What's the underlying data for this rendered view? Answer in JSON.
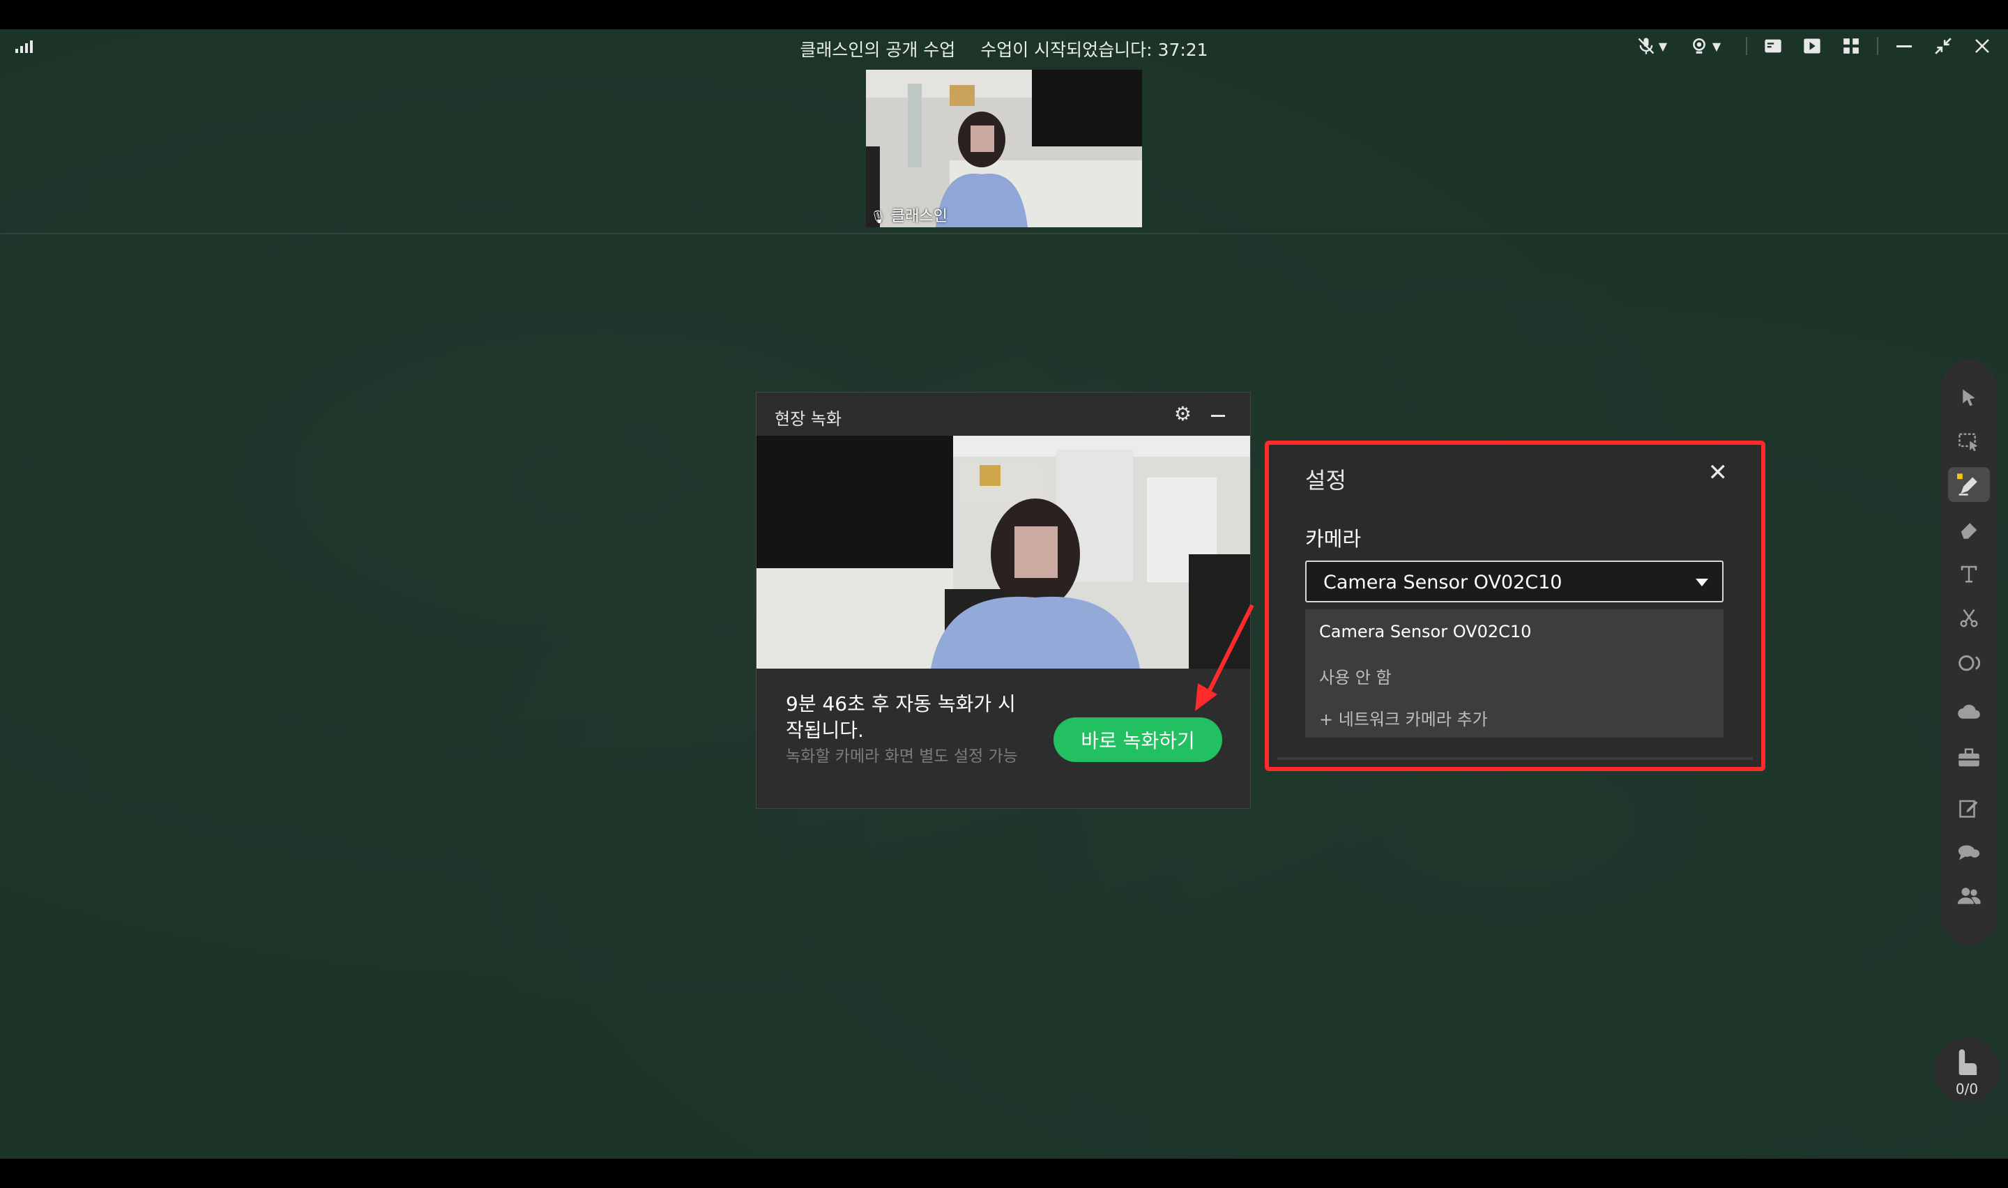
{
  "header": {
    "title": "클래스인의 공개 수업",
    "status": "수업이 시작되었습니다: 37:21"
  },
  "window_icons": {
    "mic": "microphone-muted-icon",
    "camera": "camera-icon",
    "board": "board-switch-icon",
    "play": "play-icon",
    "layout": "grid-layout-icon",
    "minimize": "minimize-icon",
    "exit_fullscreen": "exit-fullscreen-icon",
    "close": "close-icon"
  },
  "video_thumb": {
    "name": "클래스인"
  },
  "recording": {
    "title": "현장 녹화",
    "message": "9분 46초 후 자동 녹화가 시작됩니다.",
    "hint": "녹화할 카메라 화면 별도 설정 가능",
    "button": "바로 녹화하기"
  },
  "settings": {
    "title": "설정",
    "camera_label": "카메라",
    "selected": "Camera Sensor OV02C10",
    "options": [
      {
        "label": "Camera Sensor OV02C10"
      },
      {
        "label": "사용 안 함"
      },
      {
        "label": "+ 네트워크 카메라 추가"
      }
    ]
  },
  "tools": [
    {
      "icon": "cursor-icon"
    },
    {
      "icon": "selection-tool-icon"
    },
    {
      "icon": "pen-icon"
    },
    {
      "icon": "eraser-icon"
    },
    {
      "icon": "text-tool-icon"
    },
    {
      "icon": "scissors-icon"
    },
    {
      "icon": "shapes-icon"
    },
    {
      "icon": "cloud-icon"
    },
    {
      "icon": "toolbox-icon"
    },
    {
      "icon": "edit-icon"
    },
    {
      "icon": "chat-icon"
    },
    {
      "icon": "users-icon"
    }
  ],
  "hand_raise": {
    "count": "0/0"
  },
  "colors": {
    "board": "#1c3328",
    "accent": "#23c062",
    "highlight": "#ff2a2a"
  }
}
